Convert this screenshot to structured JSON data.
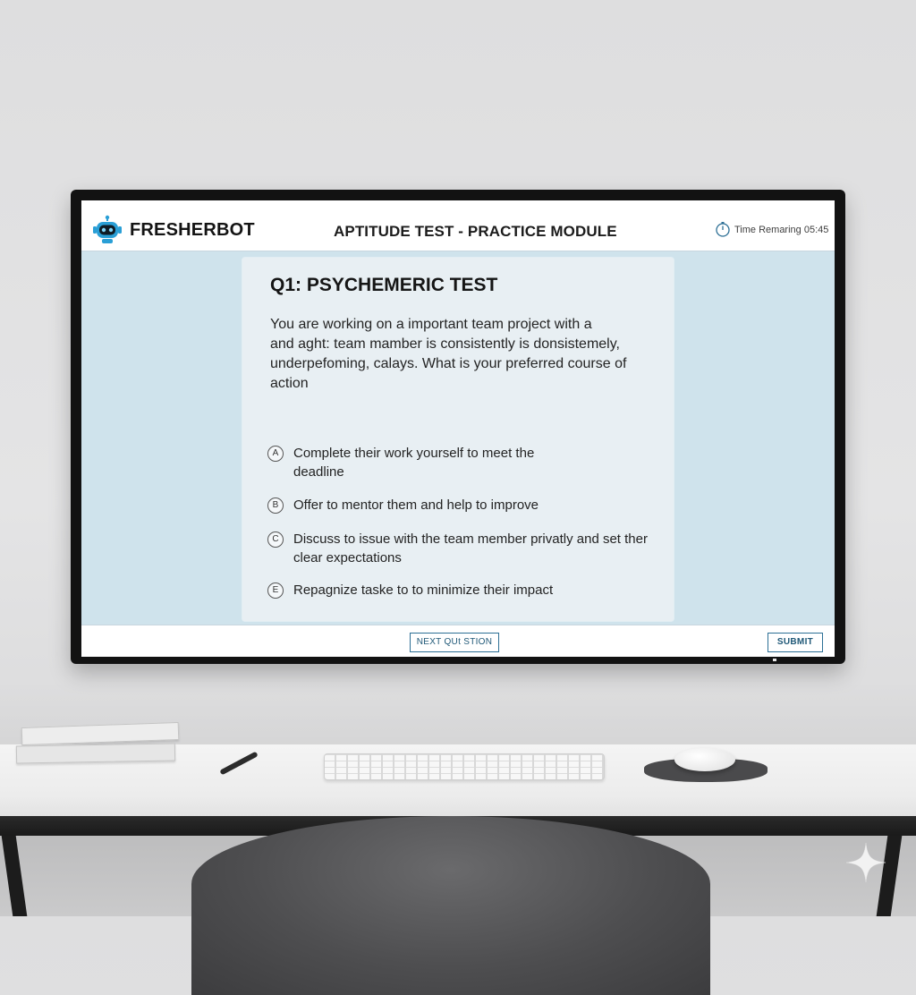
{
  "app": {
    "brand": "FRESHERBOT",
    "title": "APTITUDE TEST - PRACTICE MODULE",
    "timer": "Time Remaring 05:45"
  },
  "question": {
    "title": "Q1: PSYCHEMERIC TEST",
    "text_lines": [
      "You are working on a important team project with a",
      "and aght: team mamber is consistently is donsistemely,",
      "underpefoming, calays. What is your preferred course of",
      "action"
    ],
    "options": [
      {
        "letter": "A",
        "lines": [
          "Complete their work yourself to meet the",
          "deadline"
        ]
      },
      {
        "letter": "B",
        "lines": [
          "Offer to mentor them and help to improve"
        ]
      },
      {
        "letter": "C",
        "lines": [
          "Discuss to issue with the team member privatly and set ther",
          "clear expectations"
        ]
      },
      {
        "letter": "E",
        "lines": [
          "Repagnize taske to to minimize their impact"
        ]
      }
    ]
  },
  "footer": {
    "next_label": "NEXT QUt STION",
    "submit_label": "SUBMIT"
  },
  "colors": {
    "accent": "#2c6f95",
    "screen_bg": "#cfe3ec",
    "card_bg": "#e8eff3",
    "logo_blue": "#2a9fd6"
  },
  "icons": {
    "logo": "robot-icon",
    "timer": "stopwatch-icon",
    "corner": "sparkle-icon"
  }
}
